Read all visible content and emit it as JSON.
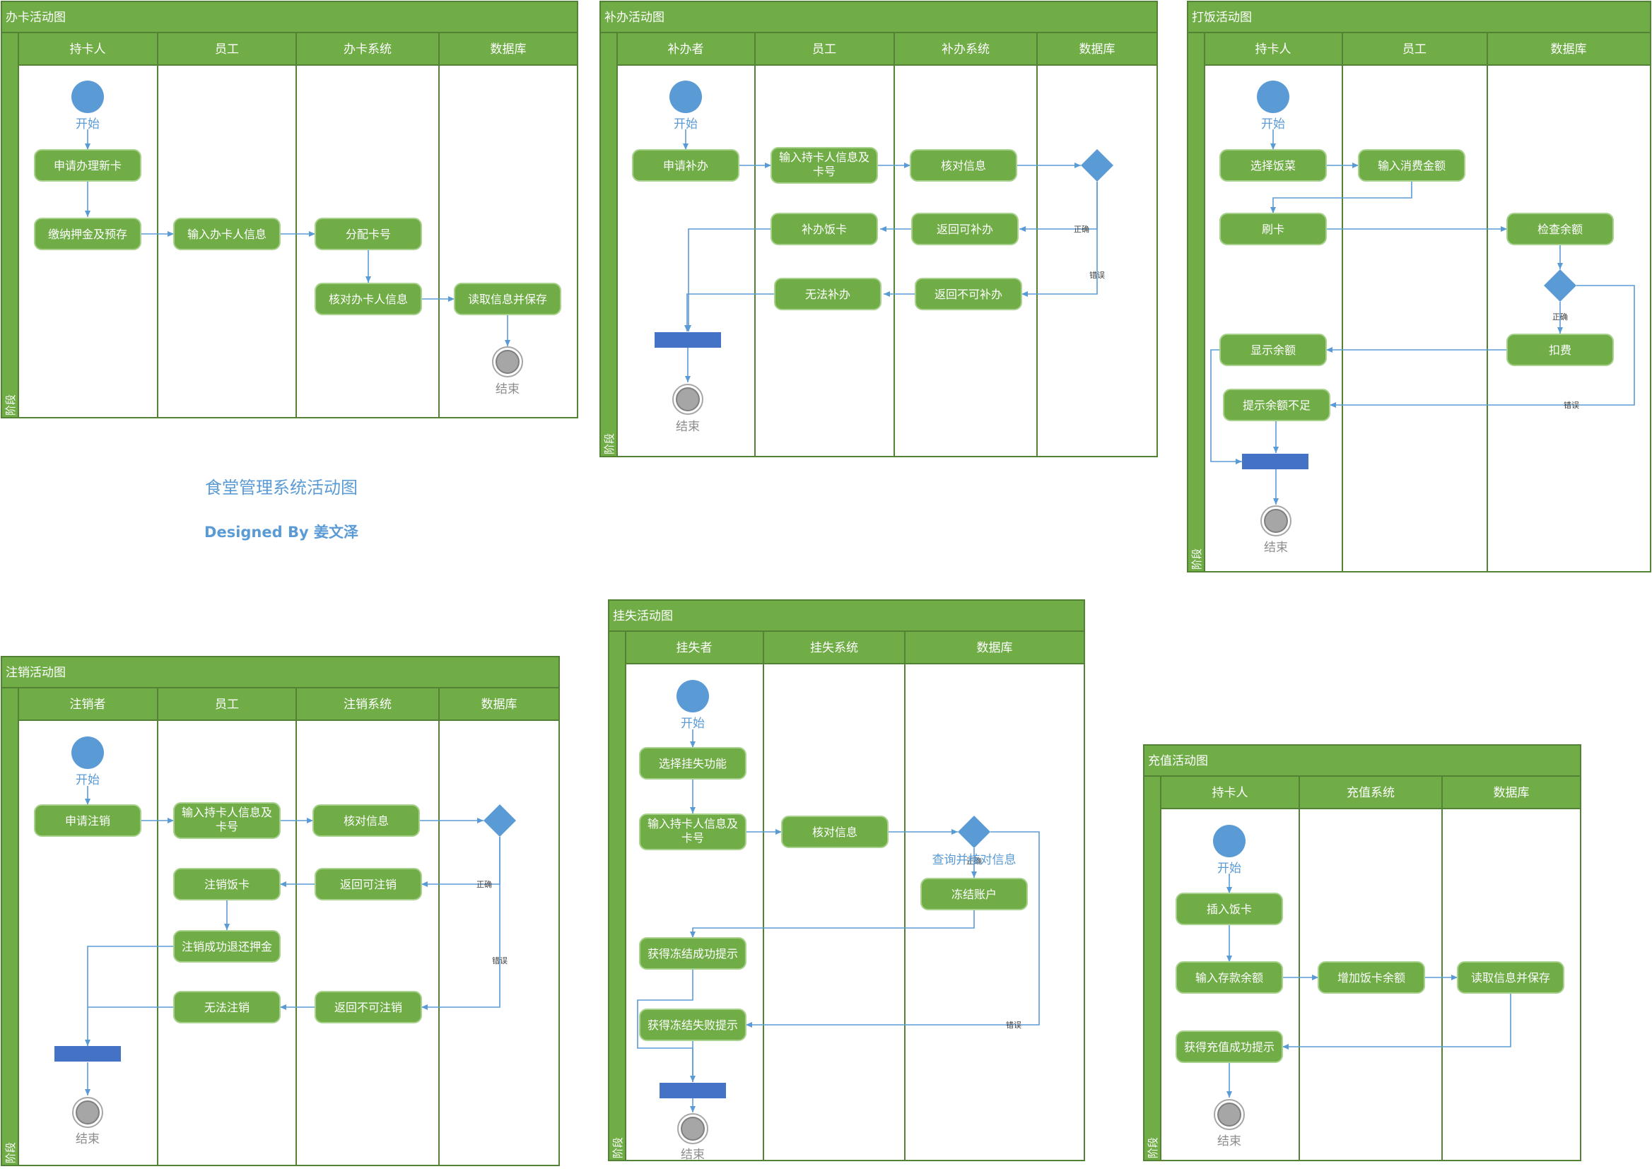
{
  "title": "食堂管理系统活动图",
  "designer": "Designed By 姜文泽",
  "common": {
    "start": "开始",
    "end": "结束",
    "stage": "阶段",
    "yes": "正确",
    "no": "错误"
  },
  "colors": {
    "panel_header": "#70AD47",
    "border": "#548235",
    "flow": "#5B9BD5",
    "fork_bar": "#4472C4",
    "end_node": "#A6A6A6"
  },
  "banka": {
    "title": "办卡活动图",
    "lanes": [
      "持卡人",
      "员工",
      "办卡系统",
      "数据库"
    ],
    "a1": "申请办理新卡",
    "a2": "缴纳押金及预存",
    "a3": "输入办卡人信息",
    "a4": "分配卡号",
    "a5": "核对办卡人信息",
    "a6": "读取信息并保存"
  },
  "buban": {
    "title": "补办活动图",
    "lanes": [
      "补办者",
      "员工",
      "补办系统",
      "数据库"
    ],
    "a1": "申请补办",
    "a2a": "输入持卡人信息及",
    "a2b": "卡号",
    "a3": "核对信息",
    "a4": "补办饭卡",
    "a5": "返回可补办",
    "a6": "无法补办",
    "a7": "返回不可补办"
  },
  "dafan": {
    "title": "打饭活动图",
    "lanes": [
      "持卡人",
      "员工",
      "数据库"
    ],
    "a1": "选择饭菜",
    "a2": "输入消费金额",
    "a3": "刷卡",
    "a4": "检查余额",
    "a5": "显示余额",
    "a6": "扣费",
    "a7": "提示余额不足"
  },
  "zhuxiao": {
    "title": "注销活动图",
    "lanes": [
      "注销者",
      "员工",
      "注销系统",
      "数据库"
    ],
    "a1": "申请注销",
    "a2a": "输入持卡人信息及",
    "a2b": "卡号",
    "a3": "核对信息",
    "a4": "注销饭卡",
    "a5": "返回可注销",
    "a6": "注销成功退还押金",
    "a7": "无法注销",
    "a8": "返回不可注销"
  },
  "guashi": {
    "title": "挂失活动图",
    "lanes": [
      "挂失者",
      "挂失系统",
      "数据库"
    ],
    "a1": "选择挂失功能",
    "a2a": "输入持卡人信息及",
    "a2b": "卡号",
    "a3": "核对信息",
    "note": "查询并核对信息",
    "a4": "冻结账户",
    "a5": "获得冻结成功提示",
    "a6": "获得冻结失败提示"
  },
  "chongzhi": {
    "title": "充值活动图",
    "lanes": [
      "持卡人",
      "充值系统",
      "数据库"
    ],
    "a1": "插入饭卡",
    "a2": "输入存款余额",
    "a3": "增加饭卡余额",
    "a4": "读取信息并保存",
    "a5": "获得充值成功提示"
  }
}
